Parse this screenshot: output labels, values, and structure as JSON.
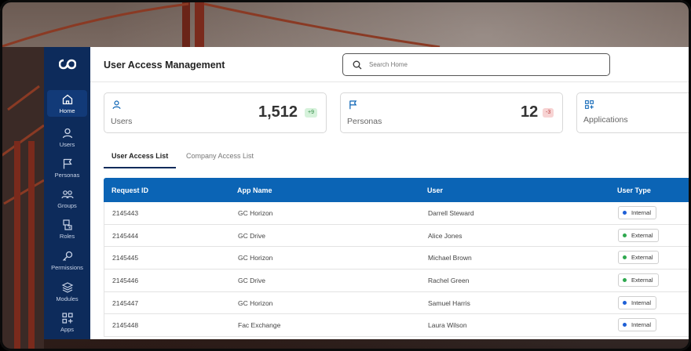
{
  "app": {
    "title": "User Access Management",
    "colors": {
      "sidebar": "#0d2b5b",
      "table_header": "#0b64b5",
      "internal_dot": "#1e5fd6",
      "external_dot": "#2fa84f"
    }
  },
  "search": {
    "placeholder": "Search Home",
    "icon": "search-icon"
  },
  "sidebar": {
    "logo_icon": "infinity-logo-icon",
    "items": [
      {
        "label": "Home",
        "icon": "home-icon",
        "active": true
      },
      {
        "label": "Users",
        "icon": "user-icon",
        "active": false
      },
      {
        "label": "Personas",
        "icon": "flag-icon",
        "active": false
      },
      {
        "label": "Groups",
        "icon": "group-icon",
        "active": false
      },
      {
        "label": "Roles",
        "icon": "roles-icon",
        "active": false
      },
      {
        "label": "Permissions",
        "icon": "key-icon",
        "active": false
      },
      {
        "label": "Modules",
        "icon": "layers-icon",
        "active": false
      },
      {
        "label": "Apps",
        "icon": "apps-icon",
        "active": false
      }
    ]
  },
  "stats": [
    {
      "label": "Users",
      "value": "1,512",
      "delta": "+9",
      "icon": "user-icon"
    },
    {
      "label": "Personas",
      "value": "12",
      "delta": "-3",
      "icon": "flag-icon"
    },
    {
      "label": "Applications",
      "icon": "apps-icon"
    }
  ],
  "tabs": [
    {
      "label": "User Access List",
      "active": true
    },
    {
      "label": "Company Access List",
      "active": false
    }
  ],
  "table": {
    "columns": [
      "Request ID",
      "App Name",
      "User",
      "User Type"
    ],
    "rows": [
      {
        "id": "2145443",
        "app": "GC Horizon",
        "user": "Darrell Steward",
        "type": "Internal"
      },
      {
        "id": "2145444",
        "app": "GC Drive",
        "user": "Alice Jones",
        "type": "External"
      },
      {
        "id": "2145445",
        "app": "GC Horizon",
        "user": "Michael Brown",
        "type": "External"
      },
      {
        "id": "2145446",
        "app": "GC Drive",
        "user": "Rachel Green",
        "type": "External"
      },
      {
        "id": "2145447",
        "app": "GC Horizon",
        "user": "Samuel Harris",
        "type": "Internal"
      },
      {
        "id": "2145448",
        "app": "Fac Exchange",
        "user": "Laura Wilson",
        "type": "Internal"
      }
    ]
  }
}
